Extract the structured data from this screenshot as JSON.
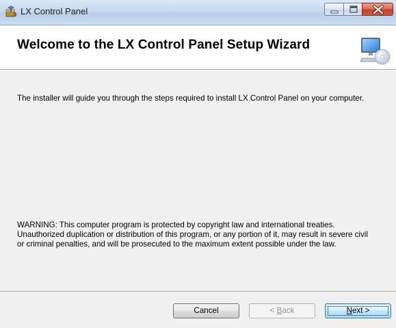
{
  "window": {
    "title": "LX Control Panel",
    "icon": "installer-package-icon",
    "controls": {
      "minimize": "minimize-icon",
      "maximize": "maximize-icon",
      "close": "close-icon"
    }
  },
  "banner": {
    "title": "Welcome to the LX Control Panel Setup Wizard",
    "graphic": "computer-cd-icon"
  },
  "body": {
    "intro": "The installer will guide you through the steps required to install LX Control Panel on your computer.",
    "warning_lines": [
      "WARNING: This computer program is protected by copyright law and international treaties.",
      "Unauthorized duplication or distribution of this program, or any portion of it, may result in severe civil",
      "or criminal penalties, and will be prosecuted to the maximum extent possible under the law."
    ]
  },
  "buttons": {
    "cancel": {
      "label": "Cancel",
      "enabled": true
    },
    "back": {
      "prefix": "< ",
      "accel": "B",
      "rest": "ack",
      "enabled": false
    },
    "next": {
      "accel": "N",
      "rest": "ext >",
      "enabled": true,
      "default": true
    }
  },
  "colors": {
    "dialog_bg": "#f0f0f0",
    "banner_bg": "#ffffff",
    "default_button_border": "#3c7fb1",
    "close_button": "#c3412a"
  }
}
